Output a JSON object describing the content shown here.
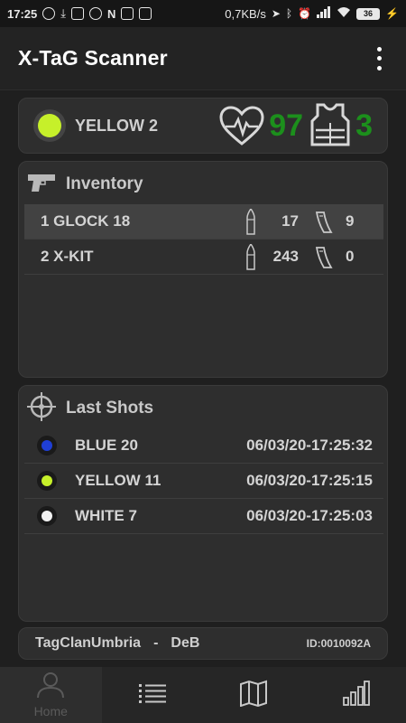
{
  "status_bar": {
    "time": "17:25",
    "network_speed": "0,7KB/s",
    "battery": "36"
  },
  "app": {
    "title": "X-TaG Scanner"
  },
  "player": {
    "name": "YELLOW 2",
    "team_color": "#c6f02a",
    "health": "97",
    "armor": "3",
    "health_icon": "heart-pulse-icon",
    "armor_icon": "vest-icon"
  },
  "inventory": {
    "title": "Inventory",
    "icon": "pistol-icon",
    "items": [
      {
        "name": "1 GLOCK 18",
        "ammo": "17",
        "magazines": "9",
        "selected": true
      },
      {
        "name": "2 X-KIT",
        "ammo": "243",
        "magazines": "0",
        "selected": false
      }
    ]
  },
  "last_shots": {
    "title": "Last Shots",
    "icon": "crosshair-icon",
    "items": [
      {
        "name": "BLUE 20",
        "time": "06/03/20-17:25:32",
        "color": "#1f3fd6"
      },
      {
        "name": "YELLOW 11",
        "time": "06/03/20-17:25:15",
        "color": "#c6f02a"
      },
      {
        "name": "WHITE 7",
        "time": "06/03/20-17:25:03",
        "color": "#f2f2f2"
      }
    ]
  },
  "footer": {
    "clan": "TagClanUmbria",
    "separator": "-",
    "player_tag": "DeB",
    "id": "ID:0010092A"
  },
  "bottom_nav": {
    "home_label": "Home",
    "items": [
      "home",
      "list",
      "map",
      "stats"
    ]
  },
  "colors": {
    "accent_green": "#1c8f1c",
    "background": "#1f1f1f",
    "card": "#2e2e2e"
  }
}
